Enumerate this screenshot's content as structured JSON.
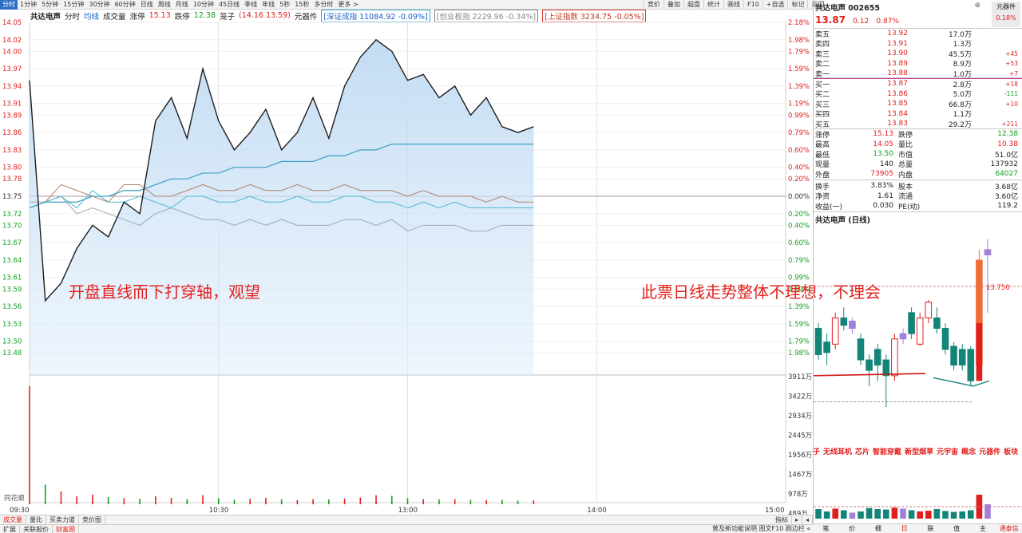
{
  "toolbar": {
    "periods": [
      "分时",
      "1分钟",
      "5分钟",
      "15分钟",
      "30分钟",
      "60分钟",
      "日线",
      "周线",
      "月线",
      "10分钟",
      "45日线",
      "季线",
      "年线",
      "5秒",
      "15秒",
      "多分时",
      "更多 >"
    ],
    "active_period": 0,
    "right_tools": [
      "竞价",
      "叠加",
      "超盘",
      "统计",
      "画线",
      "F10",
      "+自选",
      "标记",
      "返回"
    ]
  },
  "info_bar": {
    "stock": "共达电声",
    "mode": "分时",
    "avg_line": "均线",
    "volume_label": "成交量",
    "limit_up_label": "涨停",
    "limit_up_value": "15.13",
    "limit_down_label": "跌停",
    "limit_down_value": "12.38",
    "cage_label": "笼子",
    "cage_value": "(14.16 13.59)",
    "sector": "元器件",
    "szse_index": "[深证成指 11084.92 -0.09%]",
    "gem_index": "[创业板指 2229.96 -0.34%]",
    "sse_index": "[上证指数 3234.75 -0.05%]",
    "close": "⊗"
  },
  "y_axis_left": [
    "14.05",
    "14.02",
    "14.00",
    "13.97",
    "13.94",
    "13.91",
    "13.89",
    "13.86",
    "13.83",
    "13.80",
    "13.78",
    "13.75",
    "13.72",
    "13.70",
    "13.67",
    "13.64",
    "13.61",
    "13.59",
    "13.56",
    "13.53",
    "13.50",
    "13.48"
  ],
  "y_axis_right": [
    "2.18%",
    "1.98%",
    "1.79%",
    "1.59%",
    "1.39%",
    "1.19%",
    "0.99%",
    "0.79%",
    "0.60%",
    "0.40%",
    "0.20%",
    "0.00%",
    "0.20%",
    "0.40%",
    "0.60%",
    "0.79%",
    "0.99%",
    "1.19%",
    "1.39%",
    "1.59%",
    "1.79%",
    "1.98%"
  ],
  "volume_axis": [
    "3911万",
    "3422万",
    "2934万",
    "2445万",
    "1956万",
    "1467万",
    "978万",
    "489万"
  ],
  "volume_label": "同花顺",
  "time_axis": [
    "09:30",
    "10:30",
    "13:00",
    "14:00",
    "15:00"
  ],
  "price_series": [
    13.95,
    13.57,
    13.6,
    13.66,
    13.7,
    13.68,
    13.74,
    13.72,
    13.88,
    13.92,
    13.85,
    13.97,
    13.88,
    13.83,
    13.86,
    13.9,
    13.83,
    13.86,
    13.92,
    13.85,
    13.94,
    13.99,
    14.02,
    14.0,
    13.95,
    13.96,
    13.92,
    13.94,
    13.89,
    13.92,
    13.87,
    13.86,
    13.87
  ],
  "avg_series": [
    13.73,
    13.74,
    13.74,
    13.74,
    13.75,
    13.75,
    13.76,
    13.76,
    13.77,
    13.78,
    13.78,
    13.79,
    13.79,
    13.8,
    13.8,
    13.8,
    13.81,
    13.81,
    13.81,
    13.82,
    13.82,
    13.83,
    13.83,
    13.84,
    13.84,
    13.84,
    13.84,
    13.84,
    13.84,
    13.84,
    13.84,
    13.84,
    13.84
  ],
  "index_series_brown": [
    13.73,
    13.74,
    13.77,
    13.76,
    13.75,
    13.74,
    13.77,
    13.77,
    13.75,
    13.75,
    13.76,
    13.77,
    13.76,
    13.76,
    13.77,
    13.76,
    13.76,
    13.77,
    13.76,
    13.76,
    13.77,
    13.76,
    13.76,
    13.76,
    13.75,
    13.76,
    13.75,
    13.75,
    13.75,
    13.74,
    13.75,
    13.74,
    13.74
  ],
  "index_series_cyan": [
    13.73,
    13.74,
    13.75,
    13.73,
    13.76,
    13.74,
    13.74,
    13.75,
    13.74,
    13.73,
    13.75,
    13.75,
    13.74,
    13.74,
    13.75,
    13.74,
    13.74,
    13.75,
    13.74,
    13.74,
    13.75,
    13.75,
    13.74,
    13.74,
    13.73,
    13.74,
    13.73,
    13.74,
    13.73,
    13.73,
    13.73,
    13.73,
    13.73
  ],
  "index_series_gray": [
    13.74,
    13.74,
    13.75,
    13.72,
    13.73,
    13.72,
    13.71,
    13.7,
    13.72,
    13.73,
    13.72,
    13.71,
    13.71,
    13.7,
    13.71,
    13.7,
    13.71,
    13.7,
    13.7,
    13.7,
    13.71,
    13.71,
    13.7,
    13.71,
    13.69,
    13.7,
    13.7,
    13.7,
    13.69,
    13.69,
    13.7,
    13.7,
    13.7
  ],
  "volumes": [
    3911,
    650,
    420,
    260,
    320,
    240,
    200,
    180,
    260,
    210,
    170,
    300,
    200,
    150,
    180,
    210,
    160,
    140,
    170,
    160,
    190,
    220,
    300,
    280,
    200,
    170,
    160,
    170,
    150,
    140,
    150,
    120,
    130
  ],
  "annotations": {
    "left": "开盘直线而下打穿轴，观望",
    "right": "此票日线走势整体不理想，不理会"
  },
  "bottom_tabs": [
    "成交量",
    "量比",
    "买卖力道",
    "竞价图"
  ],
  "bottom_tabs2": [
    "扩展",
    "关联报价",
    "财富圈"
  ],
  "bottom_zoom": [
    "指标",
    "▸",
    "◂"
  ],
  "status_right": "普及新功能说明 图文F10 刷边栏 «",
  "right_panel": {
    "title": "共达电声 002655",
    "badge_label": "元器件",
    "badge_pct": "0.18%",
    "price": "13.87",
    "change": "0.12",
    "change_pct": "0.87%",
    "asks": [
      {
        "label": "卖五",
        "price": "13.92",
        "vol": "17.0万",
        "chg": ""
      },
      {
        "label": "卖四",
        "price": "13.91",
        "vol": "1.3万",
        "chg": ""
      },
      {
        "label": "卖三",
        "price": "13.90",
        "vol": "45.5万",
        "chg": "+45"
      },
      {
        "label": "卖二",
        "price": "13.89",
        "vol": "8.9万",
        "chg": "+53"
      },
      {
        "label": "卖一",
        "price": "13.88",
        "vol": "1.0万",
        "chg": "+7"
      }
    ],
    "bids": [
      {
        "label": "买一",
        "price": "13.87",
        "vol": "2.8万",
        "chg": "+18"
      },
      {
        "label": "买二",
        "price": "13.86",
        "vol": "5.0万",
        "chg": "-111"
      },
      {
        "label": "买三",
        "price": "13.85",
        "vol": "66.8万",
        "chg": "+10"
      },
      {
        "label": "买四",
        "price": "13.84",
        "vol": "1.1万",
        "chg": ""
      },
      {
        "label": "买五",
        "price": "13.83",
        "vol": "29.2万",
        "chg": "+211"
      }
    ],
    "stats1": [
      {
        "k1": "涨停",
        "v1": "15.13",
        "k2": "跌停",
        "v2": "12.38"
      },
      {
        "k1": "最高",
        "v1": "14.05",
        "k2": "量比",
        "v2": "10.38"
      },
      {
        "k1": "最低",
        "v1": "13.50",
        "k2": "市值",
        "v2": "51.0亿"
      },
      {
        "k1": "现量",
        "v1": "140",
        "k2": "总量",
        "v2": "137932"
      },
      {
        "k1": "外盘",
        "v1": "73905",
        "k2": "内盘",
        "v2": "64027"
      }
    ],
    "stats2": [
      {
        "k1": "换手",
        "v1": "3.83%",
        "k2": "股本",
        "v2": "3.68亿"
      },
      {
        "k1": "净资",
        "v1": "1.61",
        "k2": "流通",
        "v2": "3.60亿"
      },
      {
        "k1": "收益(一)",
        "v1": "0.030",
        "k2": "PE(动)",
        "v2": "119.2"
      }
    ],
    "daily_title": "共达电声 (日线)",
    "daily_price_label": "13.750",
    "concepts": [
      "子",
      "无线耳机",
      "芯片",
      "智能穿戴",
      "新型烟草",
      "元宇宙",
      "概念",
      "元器件",
      "板块"
    ],
    "bottom_tabs": [
      "笔",
      "价",
      "细",
      "日",
      "联",
      "值",
      "主",
      "通泰信"
    ],
    "candles": [
      {
        "o": 13.1,
        "c": 13.35,
        "h": 13.4,
        "l": 13.05,
        "col": "teal"
      },
      {
        "o": 13.12,
        "c": 13.22,
        "h": 13.3,
        "l": 13.0,
        "col": "teal"
      },
      {
        "o": 13.2,
        "c": 13.45,
        "h": 13.5,
        "l": 13.15,
        "col": "red"
      },
      {
        "o": 13.45,
        "c": 13.38,
        "h": 13.55,
        "l": 13.33,
        "col": "teal"
      },
      {
        "o": 13.35,
        "c": 13.42,
        "h": 13.45,
        "l": 13.3,
        "col": "purple"
      },
      {
        "o": 13.25,
        "c": 13.05,
        "h": 13.3,
        "l": 13.0,
        "col": "teal"
      },
      {
        "o": 13.05,
        "c": 12.95,
        "h": 13.1,
        "l": 12.8,
        "col": "teal"
      },
      {
        "o": 13.0,
        "c": 13.15,
        "h": 13.2,
        "l": 12.85,
        "col": "teal"
      },
      {
        "o": 12.9,
        "c": 13.05,
        "h": 13.1,
        "l": 12.6,
        "col": "teal"
      },
      {
        "o": 12.9,
        "c": 13.25,
        "h": 13.3,
        "l": 12.85,
        "col": "red"
      },
      {
        "o": 13.25,
        "c": 13.3,
        "h": 13.35,
        "l": 13.2,
        "col": "purple"
      },
      {
        "o": 13.3,
        "c": 13.5,
        "h": 13.55,
        "l": 13.25,
        "col": "teal"
      },
      {
        "o": 13.2,
        "c": 13.45,
        "h": 13.5,
        "l": 13.18,
        "col": "red"
      },
      {
        "o": 13.45,
        "c": 13.6,
        "h": 13.62,
        "l": 13.4,
        "col": "red"
      },
      {
        "o": 13.45,
        "c": 13.35,
        "h": 13.55,
        "l": 13.3,
        "col": "teal"
      },
      {
        "o": 13.35,
        "c": 13.15,
        "h": 13.4,
        "l": 13.1,
        "col": "teal"
      },
      {
        "o": 13.18,
        "c": 13.0,
        "h": 13.22,
        "l": 12.95,
        "col": "teal"
      },
      {
        "o": 13.0,
        "c": 13.15,
        "h": 13.2,
        "l": 12.95,
        "col": "teal"
      },
      {
        "o": 13.15,
        "c": 12.85,
        "h": 13.18,
        "l": 12.8,
        "col": "teal"
      },
      {
        "o": 13.0,
        "c": 14.0,
        "h": 14.1,
        "l": 12.95,
        "col": "bigred"
      },
      {
        "o": 14.1,
        "c": 14.05,
        "h": 14.2,
        "l": 13.5,
        "col": "purple"
      }
    ],
    "candle_volumes": [
      40,
      30,
      42,
      35,
      25,
      30,
      44,
      40,
      38,
      46,
      42,
      35,
      30,
      33,
      40,
      32,
      28,
      30,
      35,
      100,
      60
    ]
  }
}
